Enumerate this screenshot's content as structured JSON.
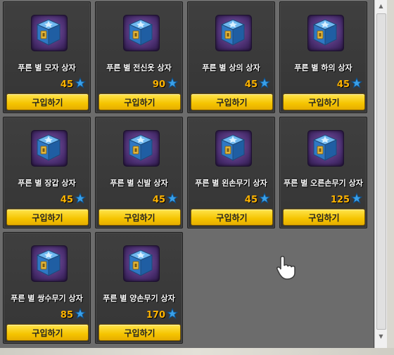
{
  "shop": {
    "button_label": "구입하기",
    "items": [
      {
        "name": "푸른 별 모자 상자",
        "price": "45",
        "icon": "blue-star-box-icon"
      },
      {
        "name": "푸른 별 전신옷 상자",
        "price": "90",
        "icon": "blue-star-box-icon"
      },
      {
        "name": "푸른 별 상의 상자",
        "price": "45",
        "icon": "blue-star-box-icon"
      },
      {
        "name": "푸른 별 하의 상자",
        "price": "45",
        "icon": "blue-star-box-icon"
      },
      {
        "name": "푸른 별 장갑 상자",
        "price": "45",
        "icon": "blue-star-box-icon"
      },
      {
        "name": "푸른 별 신발 상자",
        "price": "45",
        "icon": "blue-star-box-icon"
      },
      {
        "name": "푸른 별 왼손무기 상자",
        "price": "45",
        "icon": "blue-star-box-icon"
      },
      {
        "name": "푸른 별 오른손무기 상자",
        "price": "125",
        "icon": "blue-star-box-icon"
      },
      {
        "name": "푸른 별 쌍수무기 상자",
        "price": "85",
        "icon": "blue-star-box-icon"
      },
      {
        "name": "푸른 별 양손무기 상자",
        "price": "170",
        "icon": "blue-star-box-icon"
      }
    ]
  },
  "colors": {
    "panel_bg": "#6c6c6c",
    "card_bg": "#3a3a3a",
    "price": "#ffb400",
    "button": "#f5c400",
    "currency_star": "#3aa0e8"
  },
  "currency_icon": "blue-star-icon",
  "cursor_icon": "hand-pointer-icon"
}
